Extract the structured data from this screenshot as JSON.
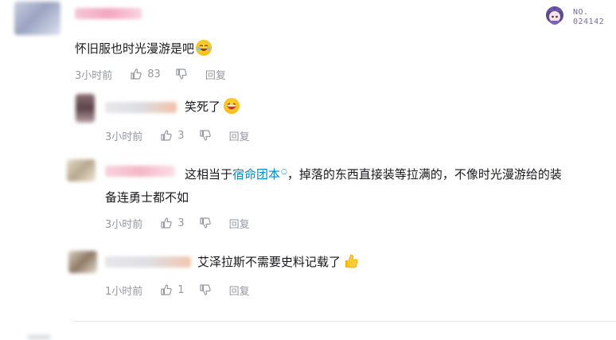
{
  "badge": {
    "label": "NO.",
    "number": "024142"
  },
  "main_comment": {
    "text": "怀旧服也时光漫游是吧",
    "time": "3小时前",
    "likes": "83",
    "reply": "回复"
  },
  "replies": [
    {
      "text": "笑死了",
      "time": "3小时前",
      "likes": "3",
      "reply": "回复"
    },
    {
      "text_before": "这相当于",
      "link": "宿命团本",
      "text_after": "，掉落的东西直接装等拉满的，不像时光漫游给的装",
      "text_line2": "备连勇士都不如",
      "time": "3小时前",
      "likes": "3",
      "reply": "回复"
    },
    {
      "text": "艾泽拉斯不需要史料记载了",
      "time": "1小时前",
      "likes": "1",
      "reply": "回复"
    }
  ]
}
